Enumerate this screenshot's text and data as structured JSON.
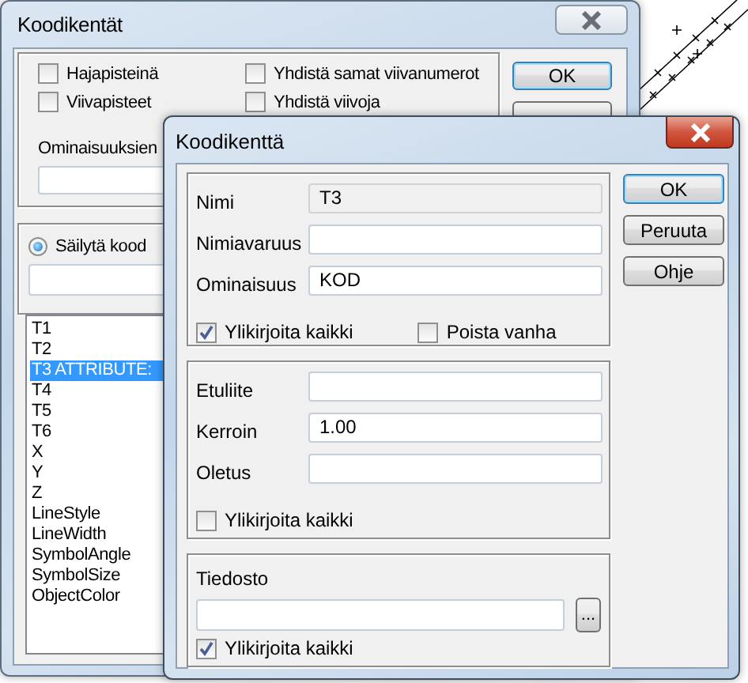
{
  "background_window": {
    "title": "Koodikentät",
    "checkboxes": [
      {
        "label": "Hajapisteinä",
        "checked": false
      },
      {
        "label": "Yhdistä samat viivanumerot",
        "checked": false
      },
      {
        "label": "Viivapisteet",
        "checked": false
      },
      {
        "label": "Yhdistä viivoja",
        "checked": false
      }
    ],
    "property_label": "Ominaisuuksien",
    "radio": {
      "label": "Säilytä kood",
      "selected": true
    },
    "list_items": [
      {
        "label": "T1",
        "selected": false
      },
      {
        "label": "T2",
        "selected": false
      },
      {
        "label": "T3  ATTRIBUTE:",
        "selected": true
      },
      {
        "label": "T4",
        "selected": false
      },
      {
        "label": "T5",
        "selected": false
      },
      {
        "label": "T6",
        "selected": false
      },
      {
        "label": "X",
        "selected": false
      },
      {
        "label": "Y",
        "selected": false
      },
      {
        "label": "Z",
        "selected": false
      },
      {
        "label": "LineStyle",
        "selected": false
      },
      {
        "label": "LineWidth",
        "selected": false
      },
      {
        "label": "SymbolAngle",
        "selected": false
      },
      {
        "label": "SymbolSize",
        "selected": false
      },
      {
        "label": "ObjectColor",
        "selected": false
      }
    ],
    "buttons": [
      "OK"
    ]
  },
  "dialog": {
    "title": "Koodikenttä",
    "groups": [
      {
        "kind": "fields",
        "fields": [
          {
            "label": "Nimi",
            "value": "T3",
            "disabled": true
          },
          {
            "label": "Nimiavaruus",
            "disabled": false
          },
          {
            "label": "Ominaisuus",
            "value": "KOD",
            "disabled": false
          }
        ],
        "checkboxes": [
          {
            "label": "Ylikirjoita kaikki",
            "checked": true
          },
          {
            "label": "Poista vanha",
            "checked": false
          }
        ]
      },
      {
        "kind": "fields",
        "fields": [
          {
            "label": "Etuliite",
            "disabled": false
          },
          {
            "label": "Kerroin",
            "value": "1.00",
            "disabled": false
          },
          {
            "label": "Oletus",
            "disabled": false
          }
        ],
        "checkboxes": [
          {
            "label": "Ylikirjoita kaikki",
            "checked": false
          }
        ]
      },
      {
        "kind": "file",
        "title": "Tiedosto",
        "browse_button": "...",
        "checkboxes": [
          {
            "label": "Ylikirjoita kaikki",
            "checked": true
          }
        ]
      }
    ],
    "buttons": [
      {
        "label": "OK",
        "default": true
      },
      {
        "label": "Peruuta",
        "default": false
      },
      {
        "label": "Ohje",
        "default": false
      }
    ]
  }
}
